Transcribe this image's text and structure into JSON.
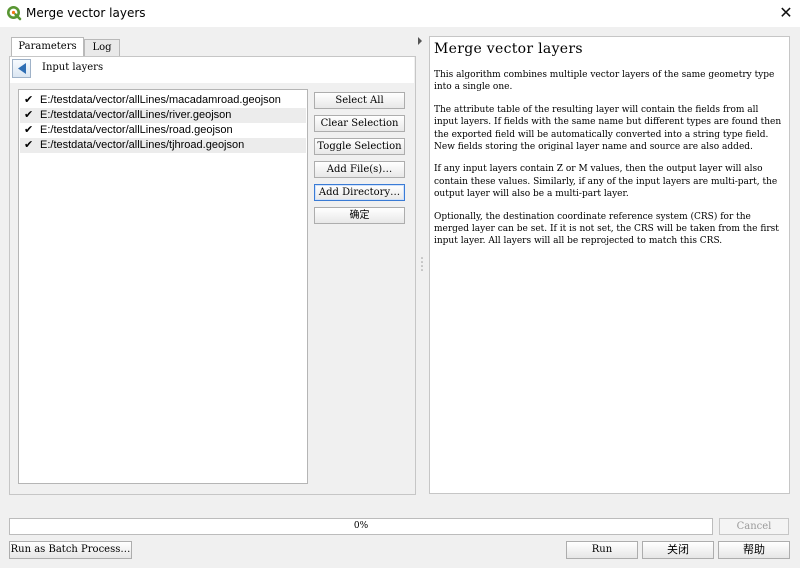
{
  "window": {
    "title": "Merge vector layers",
    "close_glyph": "✕"
  },
  "tabs": [
    {
      "label": "Parameters",
      "active": true
    },
    {
      "label": "Log",
      "active": false
    }
  ],
  "input_layers": {
    "label": "Input layers",
    "items": [
      {
        "path": "E:/testdata/vector/allLines/macadamroad.geojson",
        "checked": true
      },
      {
        "path": "E:/testdata/vector/allLines/river.geojson",
        "checked": true
      },
      {
        "path": "E:/testdata/vector/allLines/road.geojson",
        "checked": true
      },
      {
        "path": "E:/testdata/vector/allLines/tjhroad.geojson",
        "checked": true
      }
    ],
    "check_glyph": "✔"
  },
  "side_buttons": {
    "select_all": "Select All",
    "clear_selection": "Clear Selection",
    "toggle_selection": "Toggle Selection",
    "add_files": "Add File(s)…",
    "add_directory": "Add Directory…",
    "ok": "确定"
  },
  "help": {
    "title": "Merge vector layers",
    "paragraphs": [
      "This algorithm combines multiple vector layers of the same geometry type into a single one.",
      "The attribute table of the resulting layer will contain the fields from all input layers. If fields with the same name but different types are found then the exported field will be automatically converted into a string type field. New fields storing the original layer name and source are also added.",
      "If any input layers contain Z or M values, then the output layer will also contain these values. Similarly, if any of the input layers are multi-part, the output layer will also be a multi-part layer.",
      "Optionally, the destination coordinate reference system (CRS) for the merged layer can be set. If it is not set, the CRS will be taken from the first input layer. All layers will all be reprojected to match this CRS."
    ]
  },
  "progress": {
    "text": "0%",
    "value": 0
  },
  "footer": {
    "cancel": "Cancel",
    "batch": "Run as Batch Process…",
    "run": "Run",
    "close": "关闭",
    "help": "帮助"
  },
  "colors": {
    "accent": "#3a7bd5",
    "qgis_green": "#589632",
    "qgis_yellow": "#ee7913"
  }
}
